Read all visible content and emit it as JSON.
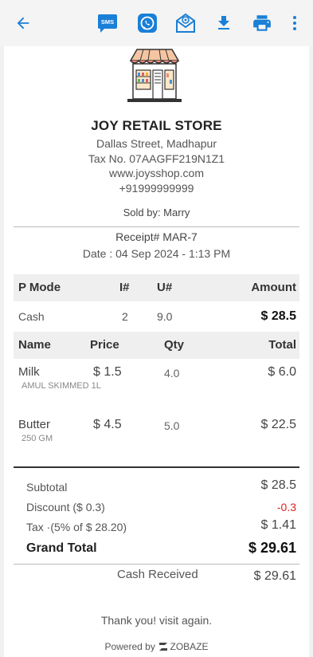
{
  "toolbar": {
    "back_icon": "arrow-left-icon",
    "sms_label": "SMS",
    "accent": "#1a7fd6"
  },
  "store": {
    "name": "JOY RETAIL STORE",
    "address": "Dallas Street, Madhapur",
    "tax_no": "Tax No. 07AAGFF219N1Z1",
    "website": "www.joysshop.com",
    "phone": "+91999999999",
    "sold_by": "Sold by: Marry"
  },
  "receipt": {
    "number": "Receipt# MAR-7",
    "date": "Date : 04 Sep 2024 - 1:13 PM"
  },
  "payment_table": {
    "headers": [
      "P Mode",
      "I#",
      "U#",
      "Amount"
    ],
    "row": {
      "mode": "Cash",
      "items": "2",
      "units": "9.0",
      "amount": "$ 28.5"
    }
  },
  "items_table": {
    "headers": [
      "Name",
      "Price",
      "Qty",
      "Total"
    ],
    "rows": [
      {
        "name": "Milk",
        "desc": "AMUL SKIMMED 1L",
        "price": "$ 1.5",
        "qty": "4.0",
        "total": "$ 6.0"
      },
      {
        "name": "Butter",
        "desc": "250 GM",
        "price": "$ 4.5",
        "qty": "5.0",
        "total": "$ 22.5"
      }
    ]
  },
  "summary": {
    "subtotal_label": "Subtotal",
    "subtotal": "$ 28.5",
    "discount_label": "Discount ($ 0.3)",
    "discount": "-0.3",
    "tax_label": "Tax  ·(5% of $ 28.20)",
    "tax": "$ 1.41",
    "grand_total_label": "Grand Total",
    "grand_total": "$ 29.61",
    "cash_received_label": "Cash Received",
    "cash_received": "$ 29.61"
  },
  "footer": {
    "thanks": "Thank you! visit again.",
    "powered_by": "Powered by",
    "brand": "ZOBAZE"
  }
}
